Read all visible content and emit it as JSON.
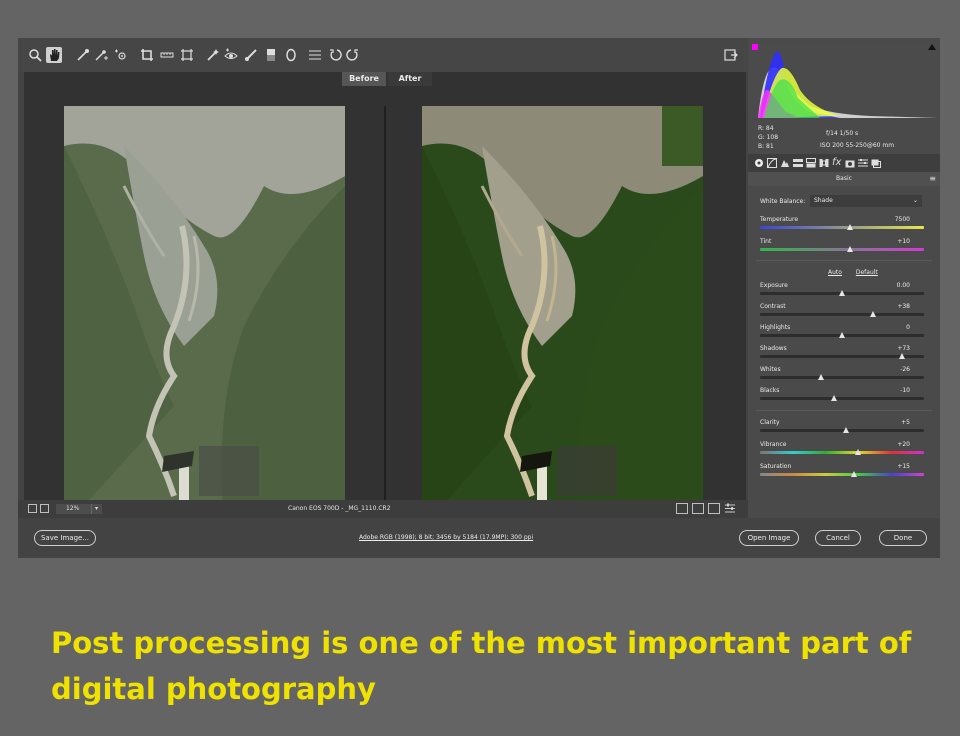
{
  "preview": {
    "before_label": "Before",
    "after_label": "After"
  },
  "status_bar": {
    "zoom": "12%",
    "file_label": "Canon EOS 700D - _MG_1110.CR2"
  },
  "readout": {
    "r": "R:   84",
    "g": "G:  108",
    "b": "B:   81",
    "aperture_shutter": "f/14   1/50 s",
    "iso_lens": "ISO 200   55-250@60 mm"
  },
  "panel": {
    "title": "Basic",
    "white_balance_label": "White Balance:",
    "white_balance_value": "Shade",
    "auto_label": "Auto",
    "default_label": "Default",
    "controls": [
      {
        "label": "Temperature",
        "value": "7500",
        "level": 0.55
      },
      {
        "label": "Tint",
        "value": "+10",
        "level": 0.55
      },
      {
        "label": "Exposure",
        "value": "0.00",
        "level": 0.5
      },
      {
        "label": "Contrast",
        "value": "+38",
        "level": 0.69
      },
      {
        "label": "Highlights",
        "value": "0",
        "level": 0.5
      },
      {
        "label": "Shadows",
        "value": "+73",
        "level": 0.865
      },
      {
        "label": "Whites",
        "value": "-26",
        "level": 0.37
      },
      {
        "label": "Blacks",
        "value": "-10",
        "level": 0.45
      },
      {
        "label": "Clarity",
        "value": "+5",
        "level": 0.525
      },
      {
        "label": "Vibrance",
        "value": "+20",
        "level": 0.6
      },
      {
        "label": "Saturation",
        "value": "+15",
        "level": 0.575
      }
    ]
  },
  "buttons": {
    "save_image": "Save Image...",
    "workflow": "Adobe RGB (1998); 8 bit; 3456 by 5184 (17.9MP); 300 ppi",
    "open_image": "Open Image",
    "cancel": "Cancel",
    "done": "Done"
  },
  "caption": "Post processing is one of the most important part of digital photography",
  "colors": {
    "caption": "#f0e200",
    "background": "#646464",
    "panel": "#4a4a4a"
  }
}
